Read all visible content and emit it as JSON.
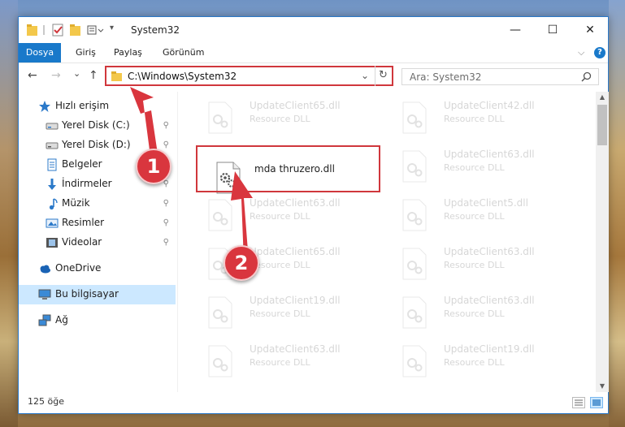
{
  "window": {
    "title": "System32",
    "minimize": "—",
    "maximize": "☐",
    "close": "✕"
  },
  "ribbon": {
    "tabs": [
      "Dosya",
      "Giriş",
      "Paylaş",
      "Görünüm"
    ],
    "expand": "⌵",
    "help": "?"
  },
  "nav": {
    "back": "←",
    "forward": "→",
    "recent": "⌄",
    "up": "↑",
    "address": "C:\\Windows\\System32",
    "address_dropdown": "⌄",
    "refresh": "↻",
    "search_placeholder": "Ara: System32"
  },
  "sidebar": {
    "items": [
      {
        "label": "Hızlı erişim",
        "icon": "star-icon",
        "pinned": false
      },
      {
        "label": "Yerel Disk (C:)",
        "icon": "drive-icon",
        "pinned": true
      },
      {
        "label": "Yerel Disk (D:)",
        "icon": "drive-icon",
        "pinned": true
      },
      {
        "label": "Belgeler",
        "icon": "document-icon",
        "pinned": true
      },
      {
        "label": "İndirmeler",
        "icon": "download-icon",
        "pinned": true
      },
      {
        "label": "Müzik",
        "icon": "music-icon",
        "pinned": true
      },
      {
        "label": "Resimler",
        "icon": "pictures-icon",
        "pinned": true
      },
      {
        "label": "Videolar",
        "icon": "video-icon",
        "pinned": true
      },
      {
        "label": "OneDrive",
        "icon": "cloud-icon",
        "pinned": false
      },
      {
        "label": "Bu bilgisayar",
        "icon": "computer-icon",
        "pinned": false
      },
      {
        "label": "Ağ",
        "icon": "network-icon",
        "pinned": false
      }
    ],
    "pin_glyph": "📌"
  },
  "files": {
    "left_column": [
      {
        "name": "UpdateClient65.dll",
        "type": "Resource DLL"
      },
      {
        "name": "mda thruzero.dll",
        "type": ""
      },
      {
        "name": "UpdateClient63.dll",
        "type": "Resource DLL"
      },
      {
        "name": "UpdateClient65.dll",
        "type": "Resource DLL"
      },
      {
        "name": "UpdateClient19.dll",
        "type": "Resource DLL"
      },
      {
        "name": "UpdateClient63.dll",
        "type": "Resource DLL"
      }
    ],
    "right_column": [
      {
        "name": "UpdateClient42.dll",
        "type": "Resource DLL"
      },
      {
        "name": "UpdateClient63.dll",
        "type": "Resource DLL"
      },
      {
        "name": "UpdateClient5.dll",
        "type": "Resource DLL"
      },
      {
        "name": "UpdateClient63.dll",
        "type": "Resource DLL"
      },
      {
        "name": "UpdateClient63.dll",
        "type": "Resource DLL"
      },
      {
        "name": "UpdateClient19.dll",
        "type": "Resource DLL"
      }
    ]
  },
  "status": {
    "count": "125 öğe"
  },
  "annotations": {
    "badge1": "1",
    "badge2": "2",
    "color": "#d9363e"
  }
}
